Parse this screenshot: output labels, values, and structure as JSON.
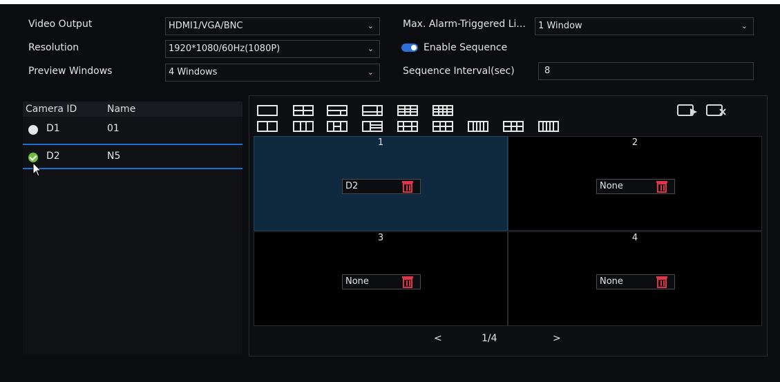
{
  "settings": {
    "video_output_label": "Video Output",
    "video_output_value": "HDMI1/VGA/BNC",
    "resolution_label": "Resolution",
    "resolution_value": "1920*1080/60Hz(1080P)",
    "preview_windows_label": "Preview Windows",
    "preview_windows_value": "4 Windows",
    "max_alarm_label": "Max. Alarm-Triggered Li...",
    "max_alarm_value": "1 Window",
    "enable_sequence_label": "Enable Sequence",
    "enable_sequence_on": true,
    "sequence_interval_label": "Sequence Interval(sec)",
    "sequence_interval_value": "8"
  },
  "camera_list": {
    "col_id": "Camera ID",
    "col_name": "Name",
    "rows": [
      {
        "id": "D1",
        "name": "01",
        "checked": false
      },
      {
        "id": "D2",
        "name": "N5",
        "checked": true
      }
    ]
  },
  "windows": [
    {
      "num": "1",
      "value": "D2",
      "selected": true
    },
    {
      "num": "2",
      "value": "None",
      "selected": false
    },
    {
      "num": "3",
      "value": "None",
      "selected": false
    },
    {
      "num": "4",
      "value": "None",
      "selected": false
    }
  ],
  "pager": {
    "prev": "<",
    "page": "1/4",
    "next": ">"
  },
  "icons": {
    "chevron": "chevron-down-icon",
    "trash": "trash-icon",
    "apply": "apply-layout-icon",
    "clear": "clear-layout-icon"
  },
  "colors": {
    "accent": "#2d6fd8",
    "selected_window": "#0f2a3e",
    "trash": "#e0344b",
    "check": "#6fbf3f"
  }
}
